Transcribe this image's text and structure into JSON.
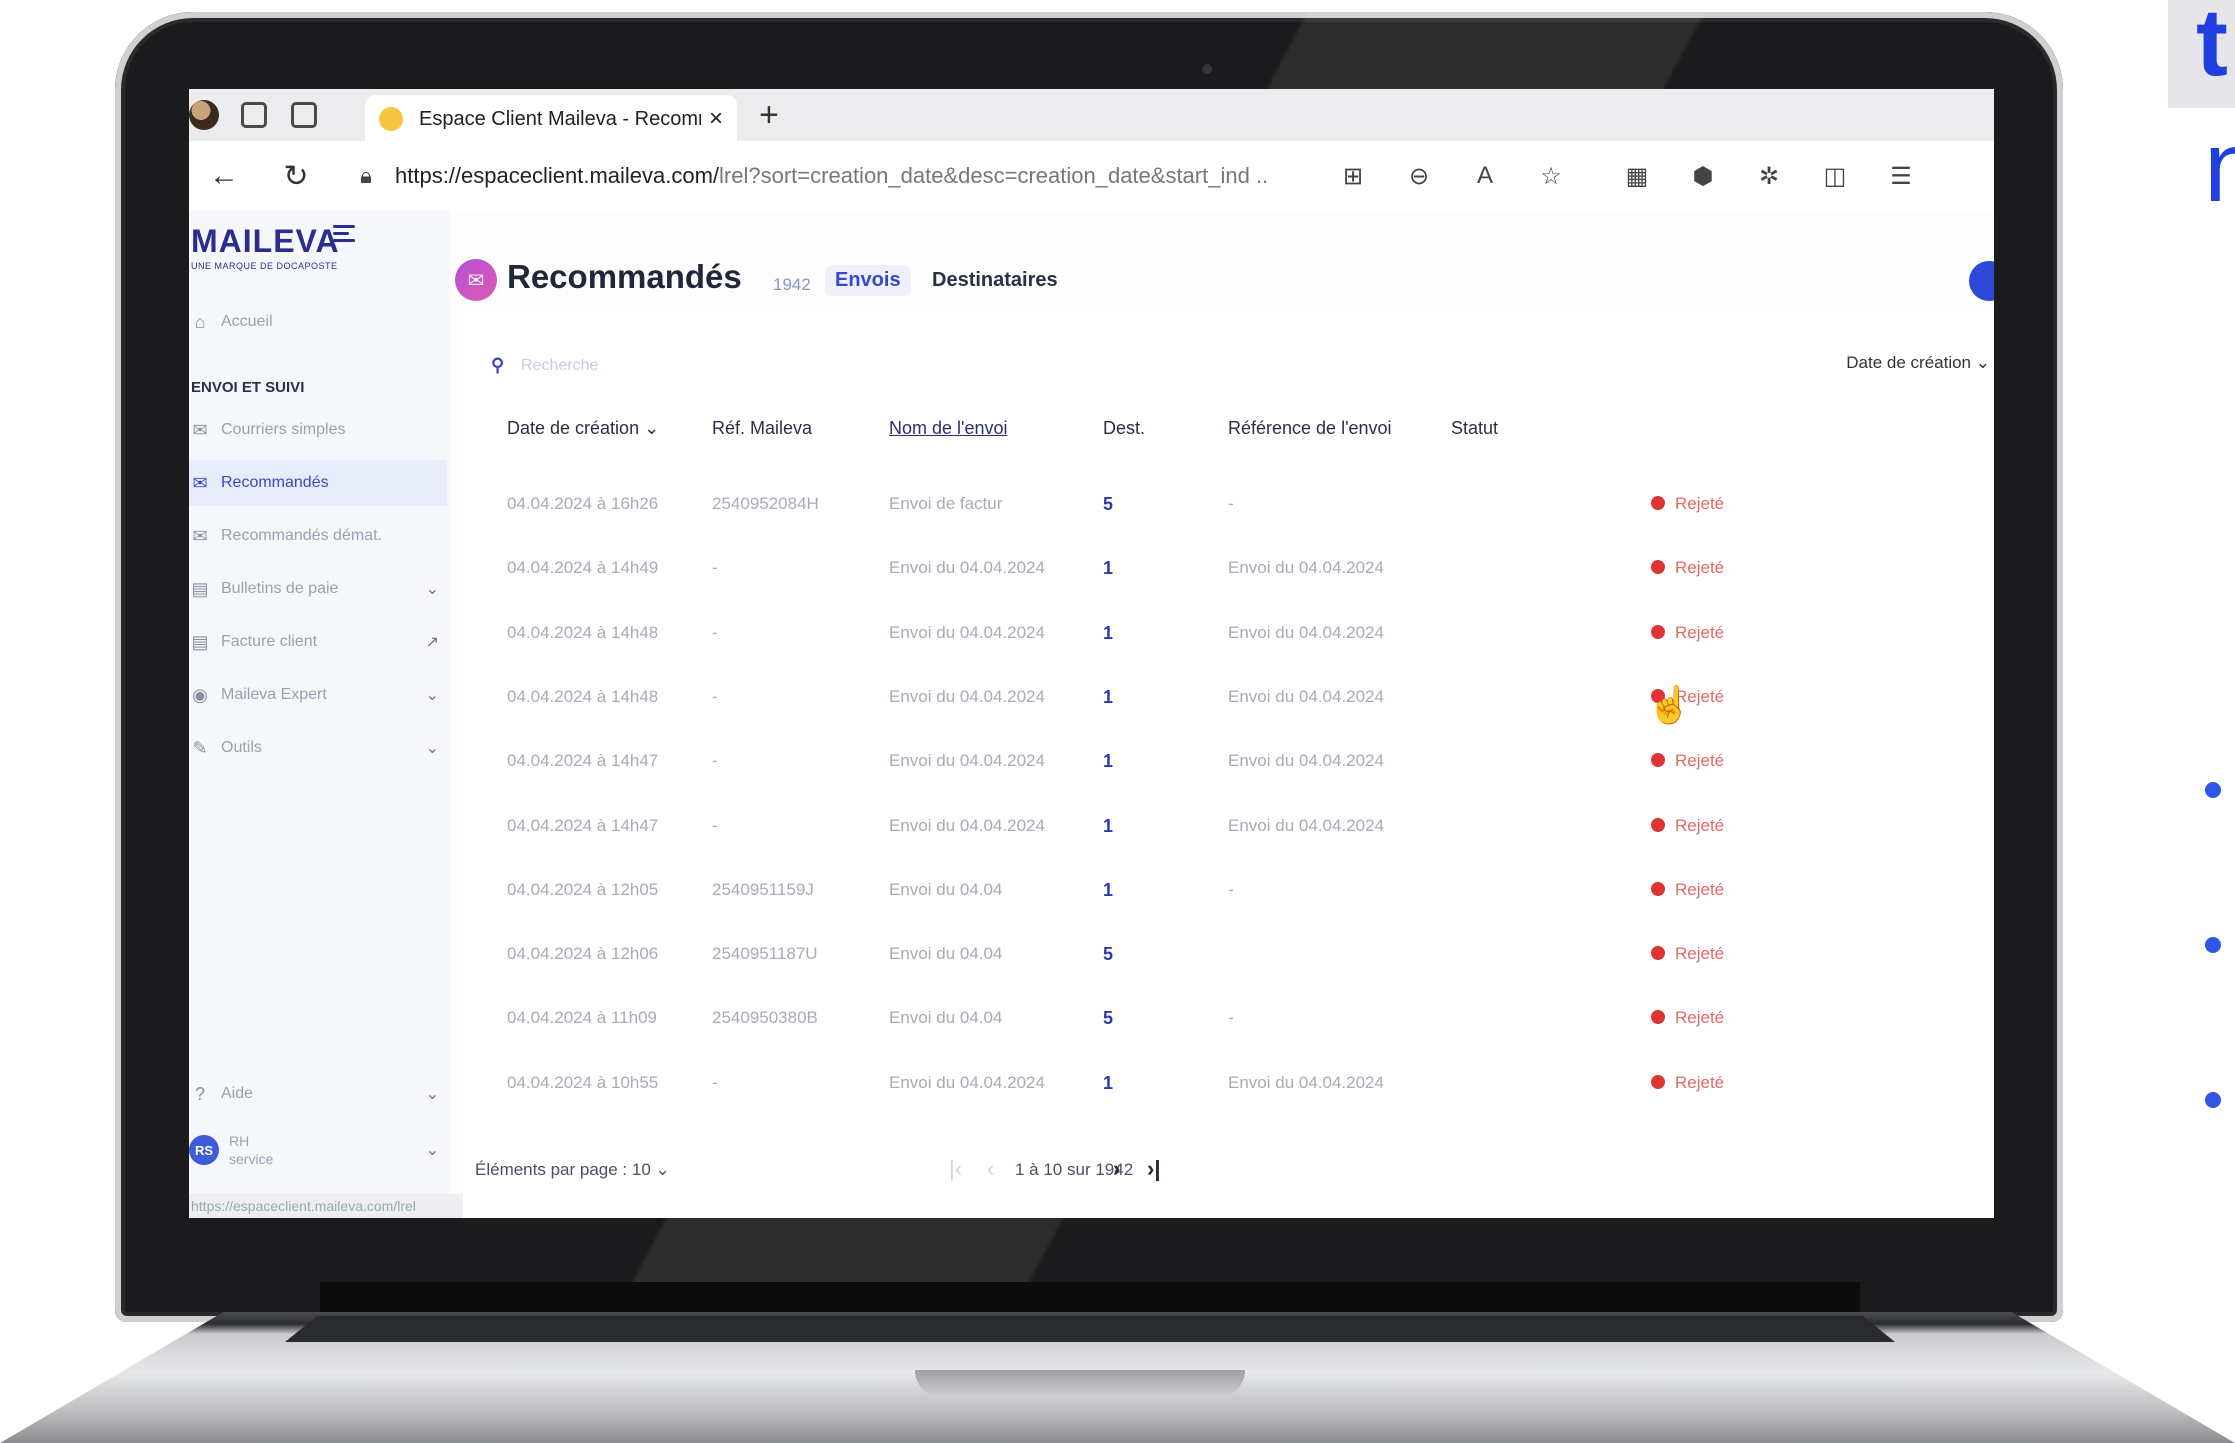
{
  "browser": {
    "tab_title": "Espace Client Maileva - Recomm",
    "tab_close": "×",
    "new_tab": "+",
    "url_main": "https://espaceclient.maileva.com/",
    "url_dim": "lrel?sort=creation_date&desc=creation_date&start_ind ..",
    "status_url": "https://espaceclient.maileva.com/lrel"
  },
  "sidebar": {
    "logo": "MAILEVA",
    "logo_sub": "UNE MARQUE DE DOCAPOSTE",
    "accueil": "Accueil",
    "section": "ENVOI ET SUIVI",
    "items": [
      "Courriers simples",
      "Recommandés",
      "Recommandés démat.",
      "Bulletins de paie",
      "Facture client",
      "Maileva Expert",
      "Outils"
    ],
    "aide": "Aide",
    "user_initials": "RS",
    "user_name": "RH",
    "user_role": "service"
  },
  "header": {
    "title": "Recommandés",
    "count": "1942",
    "tab_envois": "Envois",
    "tab_destinataires": "Destinataires"
  },
  "search": {
    "placeholder": "Recherche",
    "sort_label": "Date de création"
  },
  "table": {
    "columns": [
      "Date de création",
      "Réf. Maileva",
      "Nom de l'envoi",
      "Dest.",
      "Référence de l'envoi",
      "Statut"
    ],
    "rows": [
      {
        "date": "04.04.2024 à 16h26",
        "ref": "2540952084H",
        "name": "Envoi de factur",
        "dest": "5",
        "envoi_ref": "-",
        "status": "Rejeté"
      },
      {
        "date": "04.04.2024 à 14h49",
        "ref": "-",
        "name": "Envoi du 04.04.2024",
        "dest": "1",
        "envoi_ref": "Envoi du 04.04.2024",
        "status": "Rejeté"
      },
      {
        "date": "04.04.2024 à 14h48",
        "ref": "-",
        "name": "Envoi du 04.04.2024",
        "dest": "1",
        "envoi_ref": "Envoi du 04.04.2024",
        "status": "Rejeté"
      },
      {
        "date": "04.04.2024 à 14h48",
        "ref": "-",
        "name": "Envoi du 04.04.2024",
        "dest": "1",
        "envoi_ref": "Envoi du 04.04.2024",
        "status": "Rejeté"
      },
      {
        "date": "04.04.2024 à 14h47",
        "ref": "-",
        "name": "Envoi du 04.04.2024",
        "dest": "1",
        "envoi_ref": "Envoi du 04.04.2024",
        "status": "Rejeté"
      },
      {
        "date": "04.04.2024 à 14h47",
        "ref": "-",
        "name": "Envoi du 04.04.2024",
        "dest": "1",
        "envoi_ref": "Envoi du 04.04.2024",
        "status": "Rejeté"
      },
      {
        "date": "04.04.2024 à 12h05",
        "ref": "2540951159J",
        "name": "Envoi du 04.04",
        "dest": "1",
        "envoi_ref": "-",
        "status": "Rejeté"
      },
      {
        "date": "04.04.2024 à 12h06",
        "ref": "2540951187U",
        "name": "Envoi du 04.04",
        "dest": "5",
        "envoi_ref": "",
        "status": "Rejeté"
      },
      {
        "date": "04.04.2024 à 11h09",
        "ref": "2540950380B",
        "name": "Envoi du 04.04",
        "dest": "5",
        "envoi_ref": "-",
        "status": "Rejeté"
      },
      {
        "date": "04.04.2024 à 10h55",
        "ref": "-",
        "name": "Envoi du 04.04.2024",
        "dest": "1",
        "envoi_ref": "Envoi du 04.04.2024",
        "status": "Rejeté"
      }
    ]
  },
  "pagination": {
    "per_page": "Éléments par page : 10",
    "range": "1 à 10 sur 1942",
    "next": "›",
    "last": "›|"
  },
  "slide": {
    "letter_top": "t",
    "letter_mid": "n"
  },
  "colors": {
    "accent": "#3a47c8",
    "status_rejected": "#e03434",
    "slide_blue": "#1f3fe0"
  }
}
